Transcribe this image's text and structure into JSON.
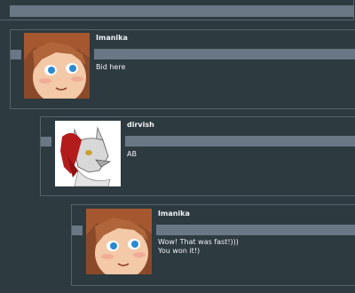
{
  "comments": [
    {
      "username": "Imanika",
      "message": "Bid here",
      "avatar_icon": "anime-character-avatar-icon"
    },
    {
      "username": "dirvish",
      "message": "AB",
      "avatar_icon": "wolf-character-avatar-icon"
    },
    {
      "username": "Imanika",
      "message": "Wow! That was fast!)))\nYou won it!)",
      "avatar_icon": "anime-character-avatar-icon"
    }
  ],
  "colors": {
    "background": "#2d3a40",
    "border": "#56636a",
    "bar": "#6a7785",
    "text": "#f1f4f6"
  }
}
